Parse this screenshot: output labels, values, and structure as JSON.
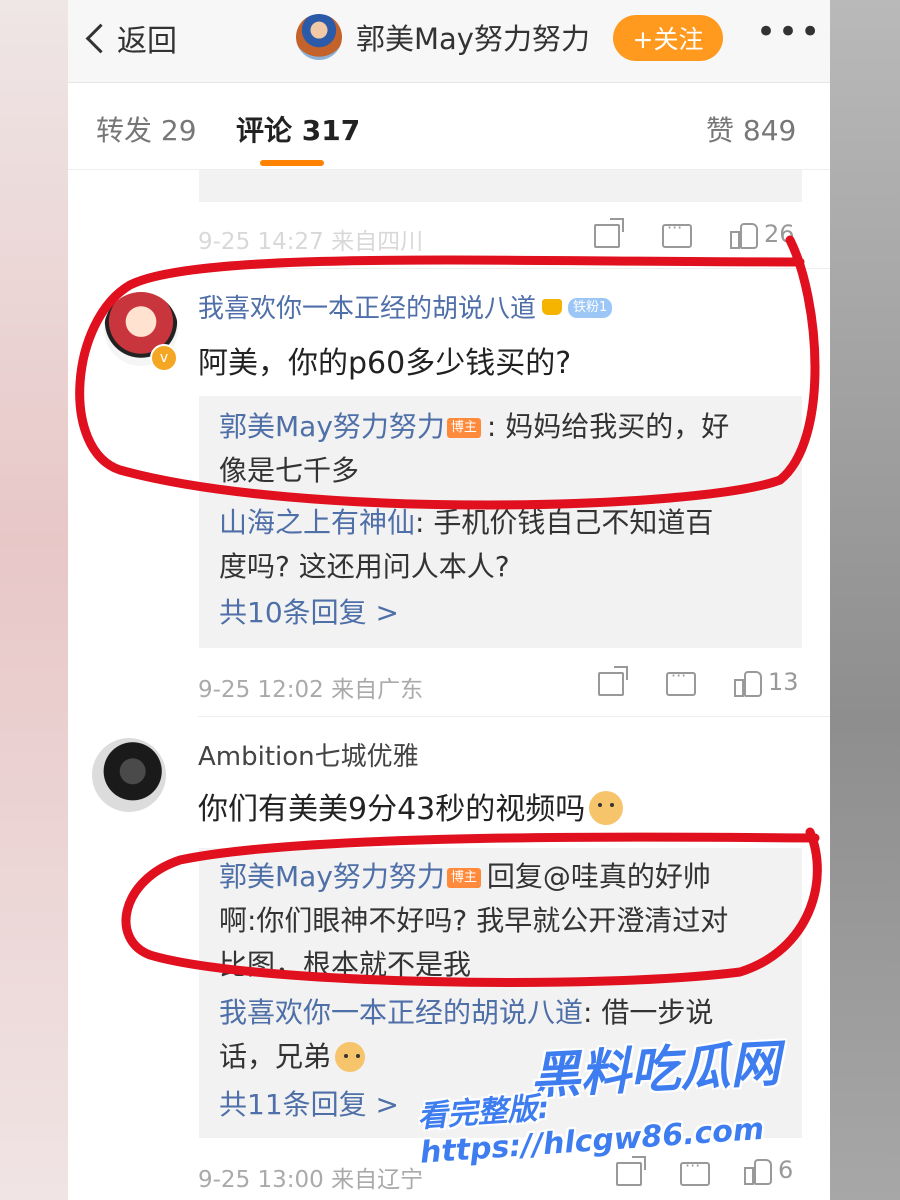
{
  "header": {
    "back_label": "返回",
    "title": "郭美May努力努力",
    "follow_label": "+关注",
    "more_label": "•••"
  },
  "tabs": [
    {
      "label": "转发 29"
    },
    {
      "label": "评论 317"
    },
    {
      "label": "赞 849"
    }
  ],
  "top_fragment": {
    "meta": "9-25 14:27 来自四川",
    "likes": "26"
  },
  "comments": [
    {
      "user": "我喜欢你一本正经的胡说八道",
      "fan_badge": "铁粉1",
      "text": "阿美，你的p60多少钱买的?",
      "replies": [
        {
          "user": "郭美May努力努力",
          "tag": "博主",
          "line1": ": 妈妈给我买的，好",
          "line2": "像是七千多"
        },
        {
          "user": "山海之上有神仙",
          "line1": ": 手机价钱自己不知道百",
          "line2": "度吗? 这还用问人本人?"
        }
      ],
      "more_replies": "共10条回复 >",
      "meta": "9-25 12:02 来自广东",
      "likes": "13"
    },
    {
      "user": "Ambition七城优雅",
      "text": "你们有美美9分43秒的视频吗",
      "replies": [
        {
          "user": "郭美May努力努力",
          "tag": "博主",
          "reply_to": "回复@哇真的好帅",
          "line1_tail": "",
          "line2": "啊:你们眼神不好吗? 我早就公开澄清过对",
          "line3": "比图，根本就不是我"
        },
        {
          "user": "我喜欢你一本正经的胡说八道",
          "line1": ": 借一步说",
          "line2": "话，兄弟"
        }
      ],
      "more_replies": "共11条回复 >",
      "meta": "9-25 13:00 来自辽宁",
      "likes": "6"
    }
  ],
  "watermark": {
    "brand": "黑料吃瓜网",
    "site": "看完整版: https://hlcgw86.com"
  },
  "colors": {
    "accent": "#ff8200",
    "follow": "#ff9a1f",
    "username": "#4f6fa8",
    "annotation": "#e0101e",
    "watermark": "#3e7df0"
  }
}
